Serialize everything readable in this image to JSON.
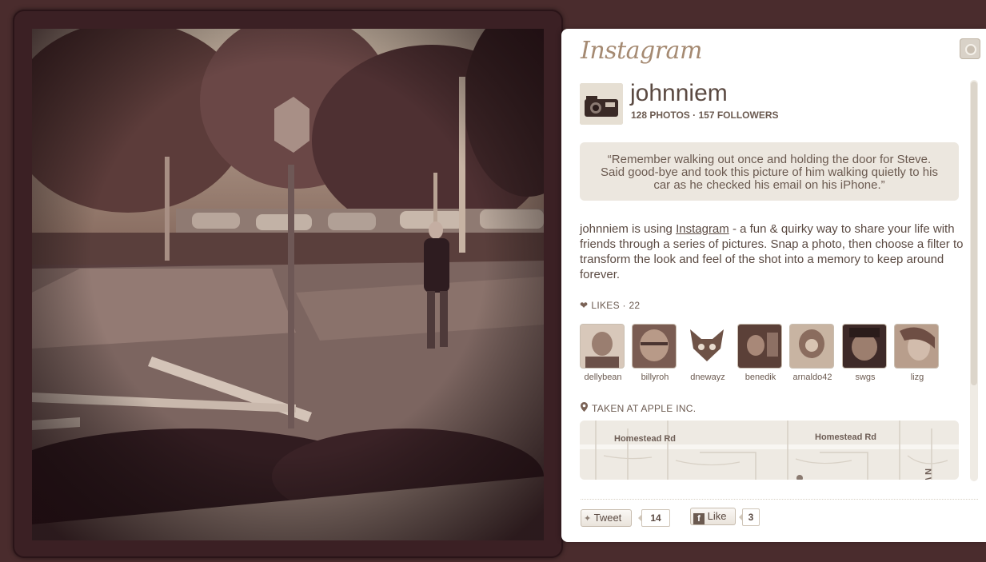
{
  "brand": {
    "logo_text": "Instagram"
  },
  "profile": {
    "username": "johnniem",
    "stats": "128 PHOTOS · 157 FOLLOWERS"
  },
  "caption": "“Remember walking out once and holding the door for Steve. Said good-bye and took this picture of him walking quietly to his car as he checked his email on his iPhone.”",
  "description": {
    "before": "johnniem is using ",
    "link": "Instagram",
    "after": " - a fun & quirky way to share your life with friends through a series of pictures. Snap a photo, then choose a filter to transform the look and feel of the shot into a memory to keep around forever."
  },
  "likes": {
    "label": "LIKES · 22",
    "users": [
      {
        "name": "dellybean",
        "tone": "#9a7e70"
      },
      {
        "name": "billyroh",
        "tone": "#a88a78"
      },
      {
        "name": "dnewayz",
        "tone": "#6e5246"
      },
      {
        "name": "benedik",
        "tone": "#7d6052"
      },
      {
        "name": "arnaldo42",
        "tone": "#b59a84"
      },
      {
        "name": "swgs",
        "tone": "#5e4238"
      },
      {
        "name": "lizg",
        "tone": "#a08272"
      }
    ]
  },
  "location": {
    "label": "TAKEN AT APPLE INC.",
    "map_labels": [
      "Homestead Rd",
      "Homestead Rd",
      "N Wolfe R"
    ]
  },
  "share": {
    "tweet_label": "Tweet",
    "tweet_count": "14",
    "like_label": "Like",
    "like_count": "3"
  },
  "colors": {
    "background": "#4a2c2d",
    "panel": "#ffffff",
    "text": "#5b4a42",
    "quote_bg": "#ece7df"
  },
  "icons": [
    "camera-icon",
    "heart-icon",
    "location-pin-icon",
    "twitter-bird-icon",
    "facebook-icon"
  ]
}
